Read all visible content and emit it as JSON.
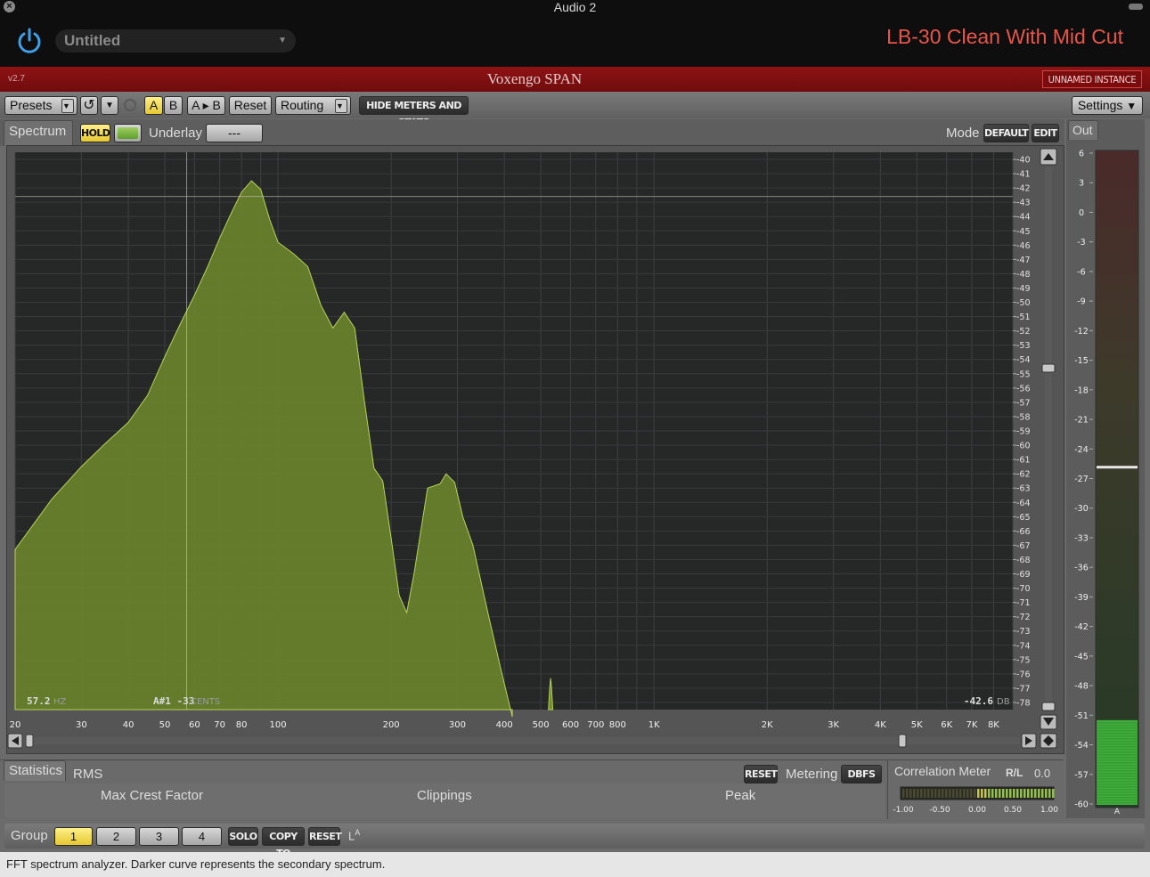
{
  "window": {
    "title": "Audio 2",
    "close_glyph": "×"
  },
  "host": {
    "preset_name": "Untitled",
    "track_label": "LB-30 Clean With Mid Cut",
    "accent_color": "#e8554a",
    "power_icon": "power-icon"
  },
  "plugin": {
    "version": "v2.7",
    "name": "Voxengo SPAN",
    "instance": "UNNAMED INSTANCE",
    "brand_color": "#8f1214"
  },
  "toolbar": {
    "presets": "Presets",
    "undo_icon": "↺",
    "a": "A",
    "b": "B",
    "a_to_b": "A ▸ B",
    "reset": "Reset",
    "routing": "Routing",
    "hide_meters": "HIDE METERS AND STATS",
    "settings": "Settings"
  },
  "spectrum": {
    "tab": "Spectrum",
    "hold": "HOLD",
    "underlay_label": "Underlay",
    "underlay_value": "---",
    "mode_label": "Mode",
    "mode_value": "DEFAULT",
    "edit": "EDIT",
    "freq_readout": "57.2",
    "freq_unit": "HZ",
    "note_readout": "A#1 -33",
    "note_unit": "CENTS",
    "db_readout": "-42.6",
    "db_unit": "DB",
    "curve_color": "#6f8a2a",
    "x_ticks": [
      "20",
      "30",
      "40",
      "50",
      "60",
      "70",
      "80",
      "100",
      "200",
      "300",
      "400",
      "500",
      "600",
      "700",
      "800",
      "1K",
      "2K",
      "3K",
      "4K",
      "5K",
      "6K",
      "7K",
      "8K"
    ],
    "y_ticks": [
      "-40",
      "-41",
      "-42",
      "-43",
      "-44",
      "-45",
      "-46",
      "-47",
      "-48",
      "-49",
      "-50",
      "-51",
      "-52",
      "-53",
      "-54",
      "-55",
      "-56",
      "-57",
      "-58",
      "-59",
      "-60",
      "-61",
      "-62",
      "-63",
      "-64",
      "-65",
      "-66",
      "-67",
      "-68",
      "-69",
      "-70",
      "-71",
      "-72",
      "-73",
      "-74",
      "-75",
      "-76",
      "-77",
      "-78"
    ]
  },
  "out": {
    "label": "Out",
    "ticks": [
      "6",
      "3",
      "0",
      "-3",
      "-6",
      "-9",
      "-12",
      "-15",
      "-18",
      "-21",
      "-24",
      "-27",
      "-30",
      "-33",
      "-36",
      "-39",
      "-42",
      "-45",
      "-48",
      "-51",
      "-54",
      "-57",
      "-60"
    ],
    "channel": "A",
    "level_db": -51.5,
    "peak_db": -25.8
  },
  "stats": {
    "tab": "Statistics",
    "mode": "RMS",
    "reset": "RESET",
    "metering_label": "Metering",
    "metering_value": "DBFS",
    "max_crest": "Max Crest Factor",
    "clippings": "Clippings",
    "peak": "Peak"
  },
  "correlation": {
    "title": "Correlation Meter",
    "channels": "R/L",
    "value": "0.0",
    "ticks": [
      "-1.00",
      "-0.50",
      "0.00",
      "0.50",
      "1.00"
    ]
  },
  "group": {
    "label": "Group",
    "buttons": [
      "1",
      "2",
      "3",
      "4"
    ],
    "solo": "SOLO",
    "copy_to": "COPY TO",
    "reset": "RESET",
    "la": "L",
    "la_sup": "A"
  },
  "status": {
    "text": "FFT spectrum analyzer. Darker curve represents the secondary spectrum."
  }
}
